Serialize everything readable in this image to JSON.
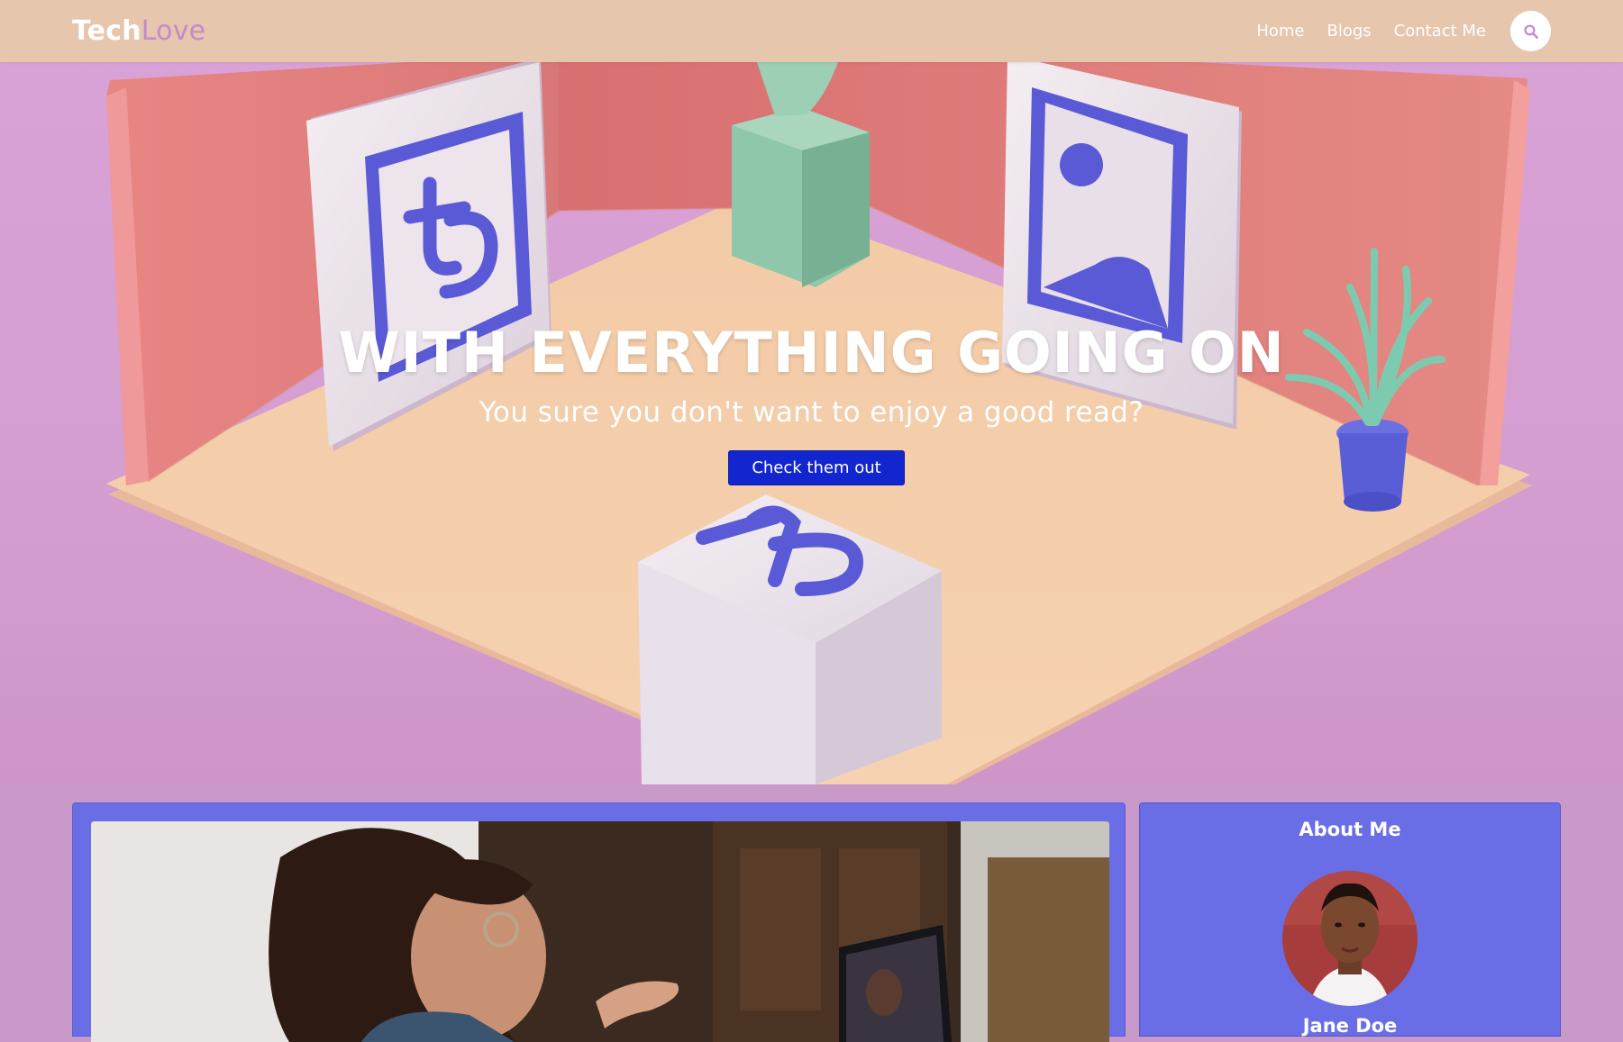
{
  "navbar": {
    "brand_part1": "Tech",
    "brand_part2": "Love",
    "links": [
      "Home",
      "Blogs",
      "Contact Me"
    ],
    "search_icon": "search-icon"
  },
  "hero": {
    "title": "WITH EVERYTHING GOING ON",
    "subtitle": "You sure you don't want to enjoy a good read?",
    "button_label": "Check them out"
  },
  "about": {
    "title": "About Me",
    "name": "Jane Doe"
  },
  "colors": {
    "navbar_bg": "#e6c6ad",
    "brand_accent": "#c58acb",
    "hero_button": "#1126cf",
    "card_bg": "#6a6ee6",
    "page_bg": "#c99ac9"
  }
}
